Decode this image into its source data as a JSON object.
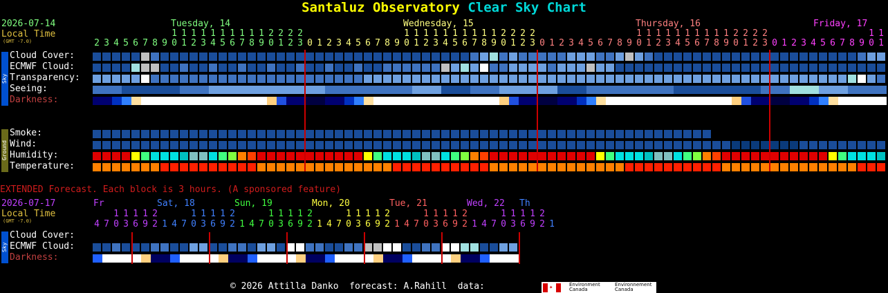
{
  "title": {
    "part1": "Santaluz Observatory",
    "part2": "Clear Sky Chart"
  },
  "header": {
    "date": "2026-07-14",
    "local_time": "Local Time",
    "gmt": "(GMT -7.0)",
    "days": [
      {
        "label": "Tuesday, 14",
        "color": "#80ff80"
      },
      {
        "label": "Wednesday, 15",
        "color": "#ffff80"
      },
      {
        "label": "Thursday, 16",
        "color": "#ff8080"
      },
      {
        "label": "Friday, 17",
        "color": "#ff40ff"
      }
    ]
  },
  "sky_labels": {
    "cloud": "Cloud Cover:",
    "ecmwf": "ECMWF Cloud:",
    "transparency": "Transparency:",
    "seeing": "Seeing:",
    "darkness": "Darkness:"
  },
  "ground_labels": {
    "smoke": "Smoke:",
    "wind": "Wind:",
    "humidity": "Humidity:",
    "temperature": "Temperature:"
  },
  "sidebar": {
    "sky": "Sky",
    "ground": "Ground"
  },
  "colors": {
    "sidebar_sky": "#0050d0",
    "sidebar_ground": "#6a6a1a",
    "darkness_label": "#c04040",
    "midnight_line": "#cc0000",
    "extended_text": "#d01c1c"
  },
  "extended": {
    "note": "EXTENDED Forecast. Each block is 3 hours. (A sponsored feature)",
    "date": "2026-07-17",
    "local_time": "Local Time",
    "gmt": "(GMT -7.0)",
    "days": [
      {
        "label": "Fr",
        "color": "#c040ff"
      },
      {
        "label": "Sat, 18",
        "color": "#4080ff"
      },
      {
        "label": "Sun, 19",
        "color": "#40ff40"
      },
      {
        "label": "Mon, 20",
        "color": "#ffff40"
      },
      {
        "label": "Tue, 21",
        "color": "#ff6060"
      },
      {
        "label": "Wed, 22",
        "color": "#c040ff"
      },
      {
        "label": "Th",
        "color": "#4080ff"
      }
    ],
    "labels": {
      "cloud": "Cloud Cover:",
      "ecmwf": "ECMWF Cloud:",
      "darkness": "Darkness:"
    }
  },
  "footer": "© 2026 Attilla Danko  forecast: A.Rahill  data:",
  "logo": {
    "en1": "Environment",
    "en2": "Canada",
    "fr1": "Environnement",
    "fr2": "Canada"
  }
}
